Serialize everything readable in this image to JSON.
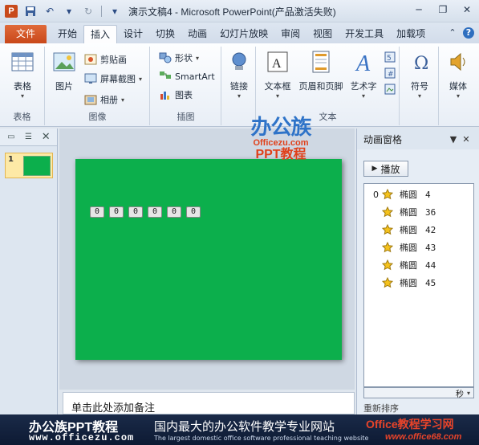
{
  "window": {
    "title": "演示文稿4 - Microsoft PowerPoint(产品激活失败)"
  },
  "tabs": {
    "file": "文件",
    "items": [
      "开始",
      "插入",
      "设计",
      "切换",
      "动画",
      "幻灯片放映",
      "审阅",
      "视图",
      "开发工具",
      "加载项"
    ],
    "active": "插入"
  },
  "ribbon": {
    "groups": {
      "table": {
        "label": "表格",
        "button": "表格"
      },
      "images": {
        "label": "图像",
        "picture": "图片",
        "clipart": "剪贴画",
        "screenshot": "屏幕截图",
        "album": "相册"
      },
      "illustrations": {
        "label": "插图",
        "shapes": "形状",
        "smartart": "SmartArt",
        "chart": "图表"
      },
      "links": {
        "label": "",
        "link": "链接"
      },
      "text": {
        "label": "文本",
        "textbox": "文本框",
        "header_footer": "页眉和页脚",
        "wordart": "艺术字"
      },
      "symbols": {
        "symbol": "符号"
      },
      "media": {
        "media": "媒体"
      }
    }
  },
  "slides_pane": {
    "slide_number": "1"
  },
  "slide": {
    "background_color": "#0caf4c",
    "oval_tags": [
      "0",
      "0",
      "0",
      "0",
      "0",
      "0"
    ]
  },
  "watermark": {
    "title": "办公族",
    "sub": "Officezu.com",
    "ppt": "PPT教程"
  },
  "notes": {
    "placeholder": "单击此处添加备注"
  },
  "animation_pane": {
    "title": "动画窗格",
    "play": "播放",
    "items": [
      {
        "num": "0",
        "name": "椭圆",
        "id": "4"
      },
      {
        "num": "",
        "name": "椭圆",
        "id": "36"
      },
      {
        "num": "",
        "name": "椭圆",
        "id": "42"
      },
      {
        "num": "",
        "name": "椭圆",
        "id": "43"
      },
      {
        "num": "",
        "name": "椭圆",
        "id": "44"
      },
      {
        "num": "",
        "name": "椭圆",
        "id": "45"
      }
    ],
    "timeline_unit": "秒",
    "reorder": "重新排序"
  },
  "banner": {
    "brand": "办公族PPT教程",
    "url": "www.officezu.com",
    "slogan": "国内最大的办公软件教学专业网站",
    "slogan_en": "The largest domestic office software professional teaching website",
    "site": "Office教程学习网",
    "site_url": "www.office68.com"
  },
  "colors": {
    "accent_file_tab": "#c9481a",
    "slide_green": "#0caf4c",
    "banner_bg": "#0d1a33"
  }
}
